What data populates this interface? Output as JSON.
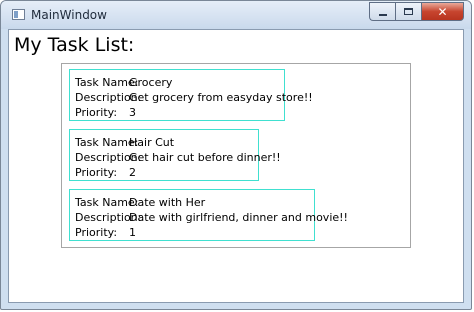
{
  "window": {
    "title": "MainWindow",
    "close_glyph": "✕"
  },
  "page": {
    "title": "My Task List:"
  },
  "labels": {
    "name": "Task Name:",
    "description": "Description:",
    "priority": "Priority:"
  },
  "tasks": [
    {
      "name": "Grocery",
      "description": "Get grocery from easyday store!!",
      "priority": "3"
    },
    {
      "name": "Hair Cut",
      "description": "Get hair cut before dinner!!",
      "priority": "2"
    },
    {
      "name": "Date with Her",
      "description": "Date with girlfriend, dinner and movie!!",
      "priority": "1"
    }
  ],
  "colors": {
    "card_border": "#40e0d0",
    "close_button": "#c7452f"
  }
}
